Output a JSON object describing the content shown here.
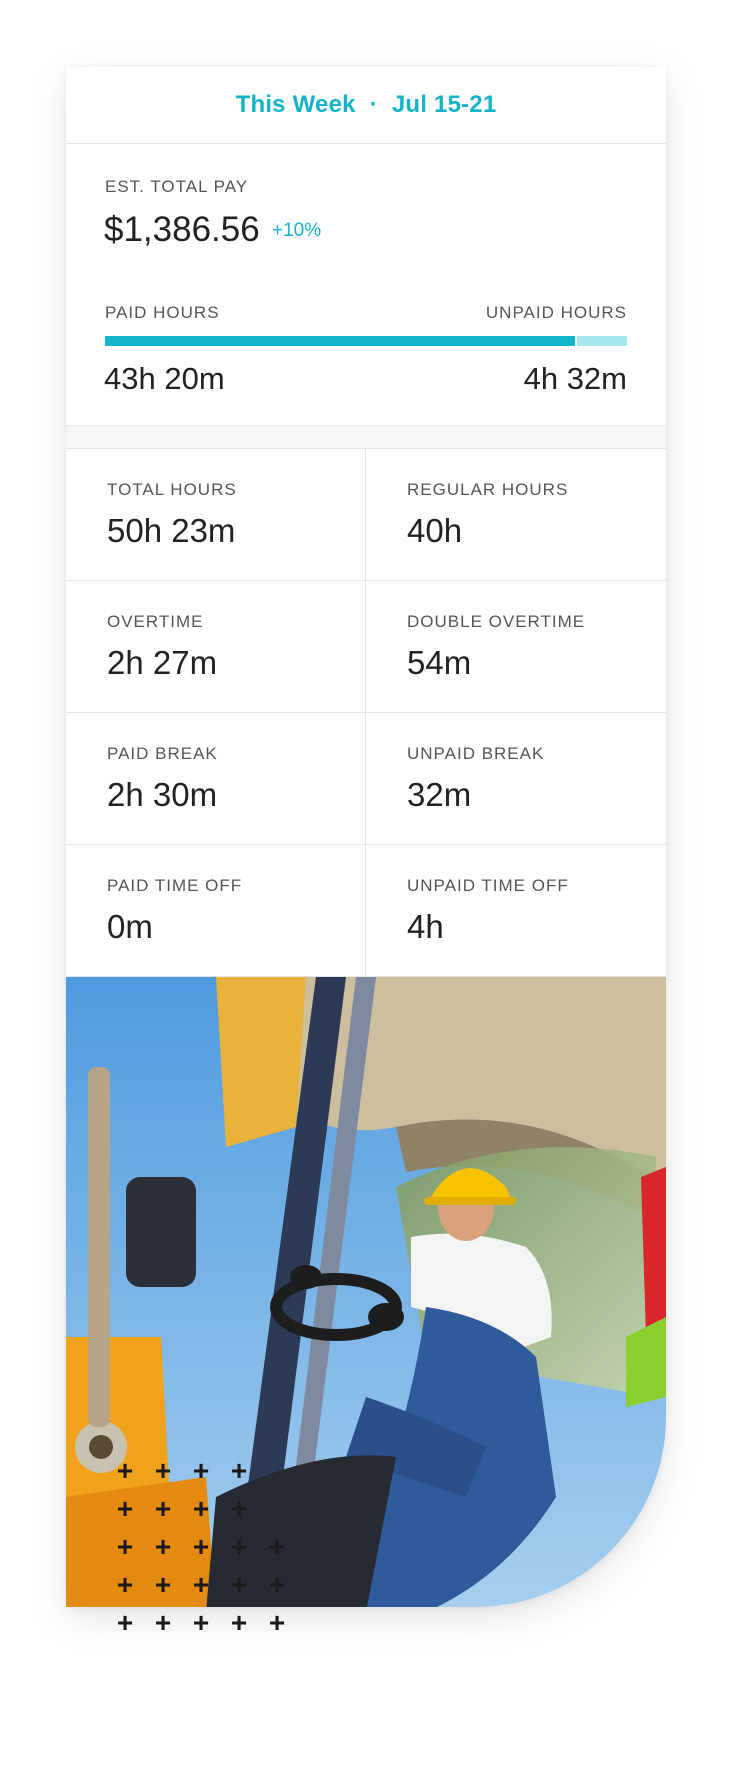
{
  "header": {
    "period": "This Week",
    "separator": "·",
    "range": "Jul 15-21"
  },
  "pay": {
    "est_label": "EST. TOTAL PAY",
    "amount": "$1,386.56",
    "change": "+10%",
    "paid_label": "PAID HOURS",
    "unpaid_label": "UNPAID HOURS",
    "paid_value": "43h 20m",
    "unpaid_value": "4h 32m",
    "paid_fraction": 0.905
  },
  "stats": [
    {
      "label": "TOTAL HOURS",
      "value": "50h 23m"
    },
    {
      "label": "REGULAR HOURS",
      "value": "40h"
    },
    {
      "label": "OVERTIME",
      "value": "2h 27m"
    },
    {
      "label": "DOUBLE OVERTIME",
      "value": "54m"
    },
    {
      "label": "PAID BREAK",
      "value": "2h 30m"
    },
    {
      "label": "UNPAID BREAK",
      "value": "32m"
    },
    {
      "label": "PAID TIME OFF",
      "value": "0m"
    },
    {
      "label": "UNPAID TIME OFF",
      "value": "4h"
    }
  ],
  "colors": {
    "accent": "#14b3c7",
    "bar_unpaid": "#a6e6ee"
  },
  "decoration": {
    "icon": "plus-icon"
  }
}
